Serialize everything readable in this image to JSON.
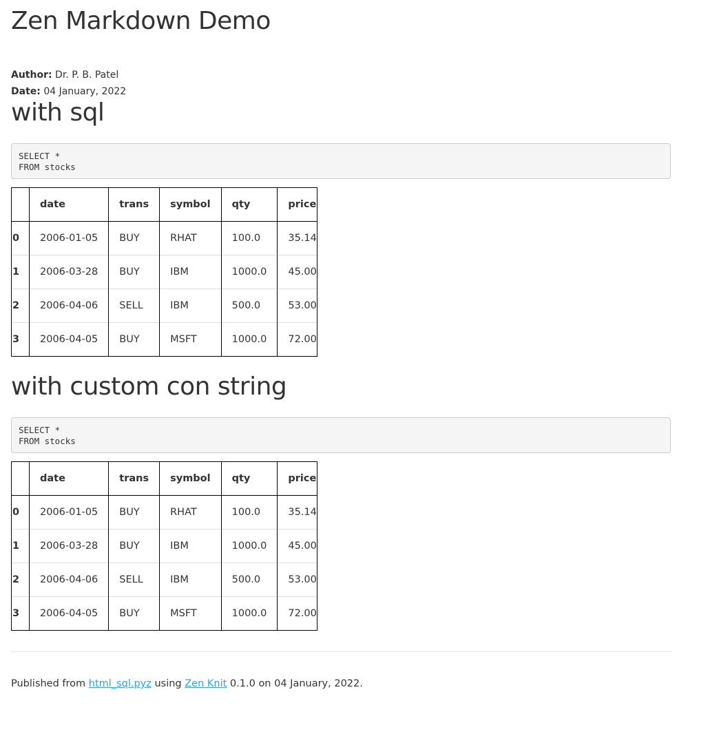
{
  "document": {
    "title": "Zen Markdown Demo",
    "author_label": "Author:",
    "author": "Dr. P. B. Patel",
    "date_label": "Date:",
    "date": "04 January, 2022"
  },
  "sections": [
    {
      "heading": "with sql",
      "code": [
        "SELECT *",
        "FROM stocks"
      ],
      "table": {
        "columns": [
          "date",
          "trans",
          "symbol",
          "qty",
          "price"
        ],
        "rows": [
          {
            "index": "0",
            "cells": [
              "2006-01-05",
              "BUY",
              "RHAT",
              "100.0",
              "35.14"
            ]
          },
          {
            "index": "1",
            "cells": [
              "2006-03-28",
              "BUY",
              "IBM",
              "1000.0",
              "45.00"
            ]
          },
          {
            "index": "2",
            "cells": [
              "2006-04-06",
              "SELL",
              "IBM",
              "500.0",
              "53.00"
            ]
          },
          {
            "index": "3",
            "cells": [
              "2006-04-05",
              "BUY",
              "MSFT",
              "1000.0",
              "72.00"
            ]
          }
        ]
      }
    },
    {
      "heading": "with custom con string",
      "code": [
        "SELECT *",
        "FROM stocks"
      ],
      "table": {
        "columns": [
          "date",
          "trans",
          "symbol",
          "qty",
          "price"
        ],
        "rows": [
          {
            "index": "0",
            "cells": [
              "2006-01-05",
              "BUY",
              "RHAT",
              "100.0",
              "35.14"
            ]
          },
          {
            "index": "1",
            "cells": [
              "2006-03-28",
              "BUY",
              "IBM",
              "1000.0",
              "45.00"
            ]
          },
          {
            "index": "2",
            "cells": [
              "2006-04-06",
              "SELL",
              "IBM",
              "500.0",
              "53.00"
            ]
          },
          {
            "index": "3",
            "cells": [
              "2006-04-05",
              "BUY",
              "MSFT",
              "1000.0",
              "72.00"
            ]
          }
        ]
      }
    }
  ],
  "footer": {
    "prefix": "Published from ",
    "source_link": "html_sql.pyz",
    "middle": " using ",
    "tool_link": "Zen Knit",
    "suffix": " 0.1.0 on 04 January, 2022."
  },
  "colors": {
    "link": "#2fa4e7",
    "code_background": "#f5f5f5",
    "text": "#333333"
  }
}
